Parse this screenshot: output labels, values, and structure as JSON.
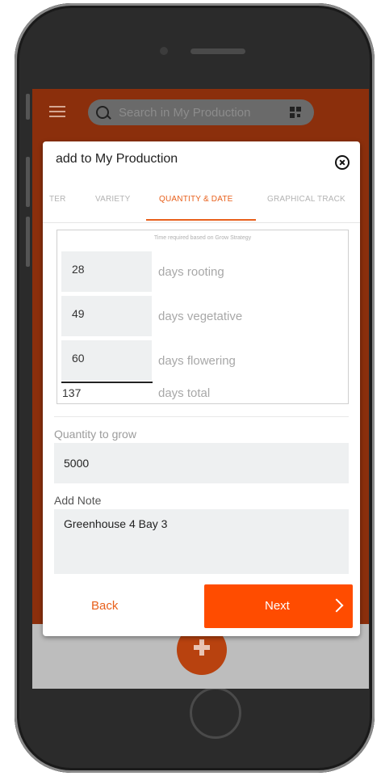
{
  "search": {
    "placeholder": "Search in My Production"
  },
  "modal": {
    "title": "add to My Production",
    "tabs": [
      {
        "label": "TER"
      },
      {
        "label": "VARIETY"
      },
      {
        "label": "QUANTITY & DATE"
      },
      {
        "label": "GRAPHICAL TRACK"
      }
    ],
    "active_tab": "QUANTITY & DATE",
    "strategy_note": "Time required based on Grow Strategy",
    "days": [
      {
        "value": "28",
        "label": "days rooting"
      },
      {
        "value": "49",
        "label": "days vegetative"
      },
      {
        "value": "60",
        "label": "days flowering"
      }
    ],
    "total": {
      "value": "137",
      "label": "days total"
    },
    "quantity": {
      "label": "Quantity to grow",
      "value": "5000"
    },
    "note": {
      "label": "Add Note",
      "value": "Greenhouse 4 Bay 3"
    },
    "back_label": "Back",
    "next_label": "Next"
  },
  "colors": {
    "accent": "#ff4c00",
    "header": "#8b2f0c"
  }
}
